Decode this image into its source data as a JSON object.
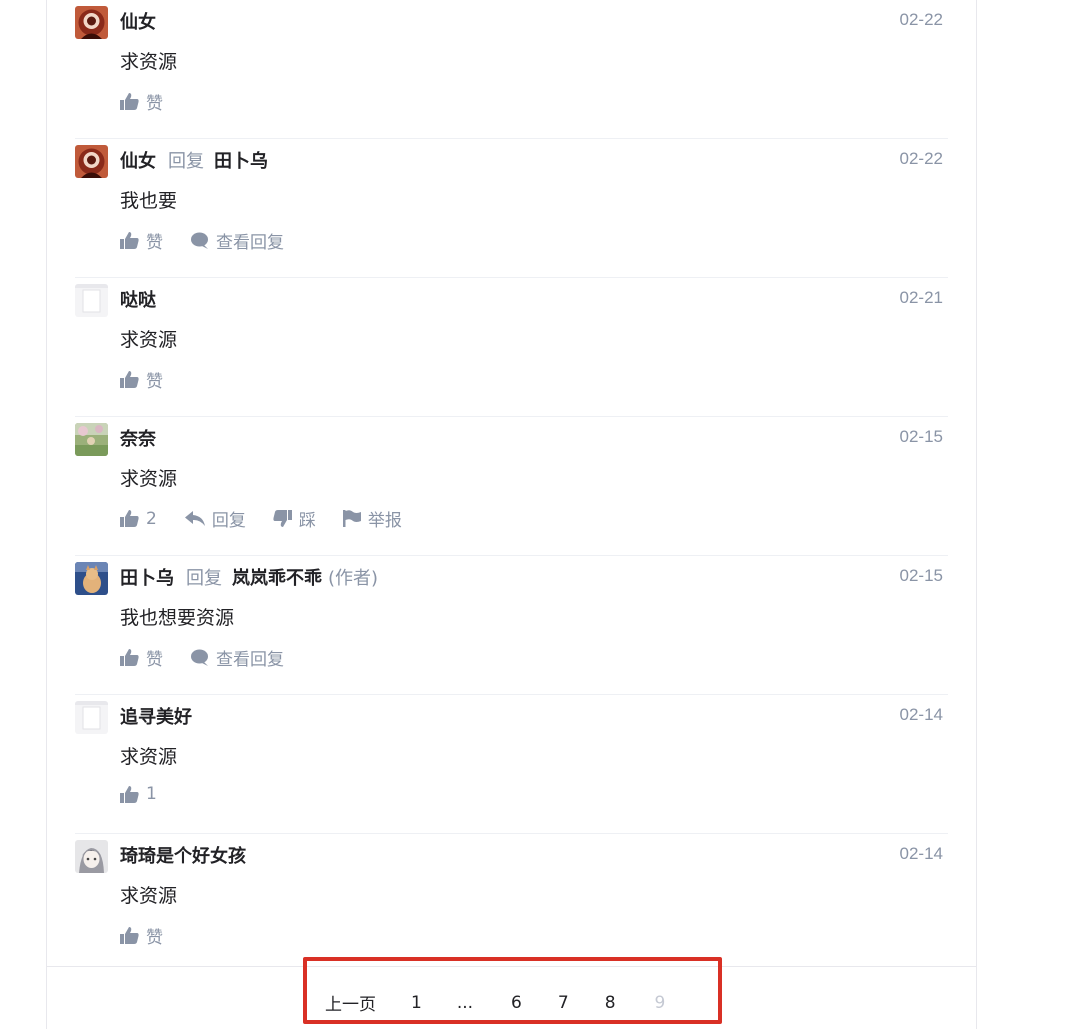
{
  "comments": [
    {
      "user": "仙女",
      "reply_word": "",
      "reply_to": "",
      "author_tag": "",
      "date": "02-22",
      "text": "求资源",
      "like_label": "赞",
      "view_replies_label": "",
      "reply_label": "",
      "dislike_label": "",
      "report_label": "",
      "avatar": "red-circle-avatar"
    },
    {
      "user": "仙女",
      "reply_word": "回复",
      "reply_to": "田卜乌",
      "author_tag": "",
      "date": "02-22",
      "text": "我也要",
      "like_label": "赞",
      "view_replies_label": "查看回复",
      "reply_label": "",
      "dislike_label": "",
      "report_label": "",
      "avatar": "red-circle-avatar"
    },
    {
      "user": "哒哒",
      "reply_word": "",
      "reply_to": "",
      "author_tag": "",
      "date": "02-21",
      "text": "求资源",
      "like_label": "赞",
      "view_replies_label": "",
      "reply_label": "",
      "dislike_label": "",
      "report_label": "",
      "avatar": "white-avatar"
    },
    {
      "user": "奈奈",
      "reply_word": "",
      "reply_to": "",
      "author_tag": "",
      "date": "02-15",
      "text": "求资源",
      "like_label": "2",
      "view_replies_label": "",
      "reply_label": "回复",
      "dislike_label": "踩",
      "report_label": "举报",
      "avatar": "garden-avatar"
    },
    {
      "user": "田卜乌",
      "reply_word": "回复",
      "reply_to": "岚岚乖不乖",
      "author_tag": "(作者)",
      "date": "02-15",
      "text": "我也想要资源",
      "like_label": "赞",
      "view_replies_label": "查看回复",
      "reply_label": "",
      "dislike_label": "",
      "report_label": "",
      "avatar": "cat-avatar"
    },
    {
      "user": "追寻美好",
      "reply_word": "",
      "reply_to": "",
      "author_tag": "",
      "date": "02-14",
      "text": "求资源",
      "like_label": "1",
      "view_replies_label": "",
      "reply_label": "",
      "dislike_label": "",
      "report_label": "",
      "avatar": "white-avatar"
    },
    {
      "user": "琦琦是个好女孩",
      "reply_word": "",
      "reply_to": "",
      "author_tag": "",
      "date": "02-14",
      "text": "求资源",
      "like_label": "赞",
      "view_replies_label": "",
      "reply_label": "",
      "dislike_label": "",
      "report_label": "",
      "avatar": "anime-avatar"
    }
  ],
  "pagination": {
    "prev_label": "上一页",
    "first": "1",
    "ellipsis": "...",
    "p6": "6",
    "p7": "7",
    "p8": "8",
    "current": "9"
  },
  "colors": {
    "text": "#222226",
    "meta": "#8a94a6",
    "highlight_box": "#d93025",
    "disabled": "#c5c9d3"
  }
}
